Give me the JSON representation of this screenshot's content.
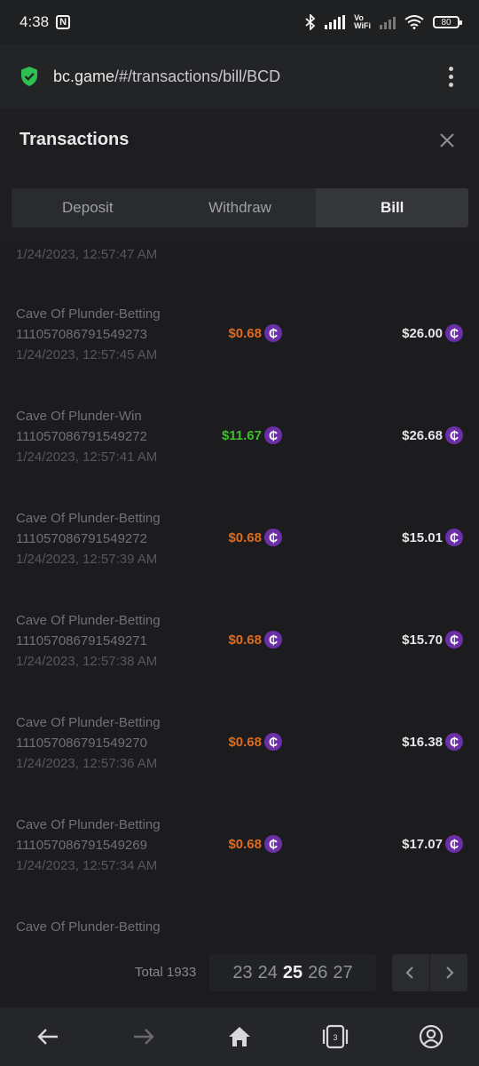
{
  "status_bar": {
    "time": "4:38",
    "battery": "80"
  },
  "browser": {
    "url_host": "bc.game",
    "url_path": "/#/transactions/bill/BCD"
  },
  "dialog": {
    "title": "Transactions",
    "tabs": [
      {
        "label": "Deposit",
        "active": false
      },
      {
        "label": "Withdraw",
        "active": false
      },
      {
        "label": "Bill",
        "active": true
      }
    ]
  },
  "transactions": {
    "partial_top_time": "1/24/2023, 12:57:47 AM",
    "rows": [
      {
        "name": "Cave Of Plunder-Betting",
        "txid": "111057086791549273",
        "time": "1/24/2023, 12:57:45 AM",
        "change": "$0.68",
        "change_type": "loss",
        "balance": "$26.00"
      },
      {
        "name": "Cave Of Plunder-Win",
        "txid": "111057086791549272",
        "time": "1/24/2023, 12:57:41 AM",
        "change": "$11.67",
        "change_type": "win",
        "balance": "$26.68"
      },
      {
        "name": "Cave Of Plunder-Betting",
        "txid": "111057086791549272",
        "time": "1/24/2023, 12:57:39 AM",
        "change": "$0.68",
        "change_type": "loss",
        "balance": "$15.01"
      },
      {
        "name": "Cave Of Plunder-Betting",
        "txid": "111057086791549271",
        "time": "1/24/2023, 12:57:38 AM",
        "change": "$0.68",
        "change_type": "loss",
        "balance": "$15.70"
      },
      {
        "name": "Cave Of Plunder-Betting",
        "txid": "111057086791549270",
        "time": "1/24/2023, 12:57:36 AM",
        "change": "$0.68",
        "change_type": "loss",
        "balance": "$16.38"
      },
      {
        "name": "Cave Of Plunder-Betting",
        "txid": "111057086791549269",
        "time": "1/24/2023, 12:57:34 AM",
        "change": "$0.68",
        "change_type": "loss",
        "balance": "$17.07"
      }
    ],
    "partial_bottom_name": "Cave Of Plunder-Betting",
    "coin_symbol": "₵"
  },
  "pagination": {
    "total": "Total 1933",
    "pages": [
      "23",
      "24",
      "25",
      "26",
      "27"
    ],
    "current": "25"
  },
  "colors": {
    "loss": "#e06b1c",
    "win": "#3fbd2a",
    "coin": "#6b2fa8",
    "shield": "#2fbf52"
  }
}
